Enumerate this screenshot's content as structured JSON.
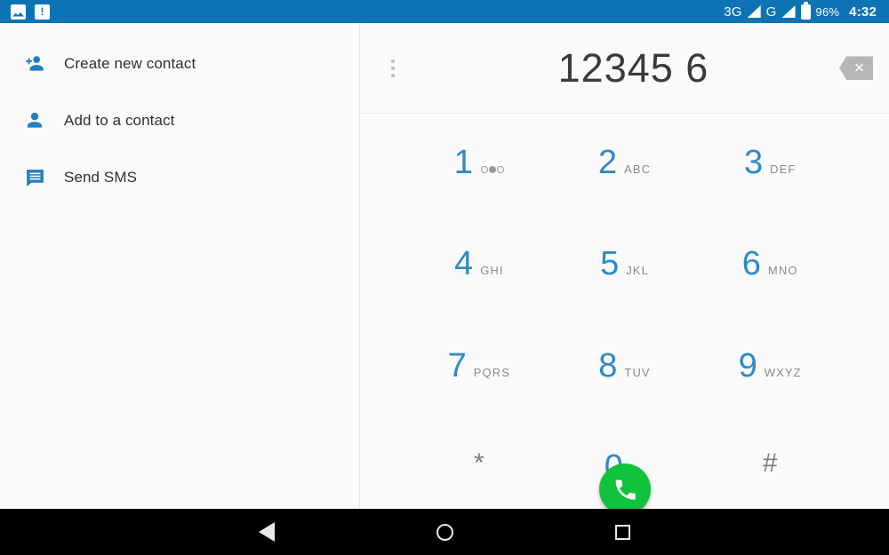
{
  "status_bar": {
    "notifications": [
      {
        "name": "screenshot-icon"
      },
      {
        "name": "document-alert-icon"
      }
    ],
    "network_1": "3G",
    "network_2": "G",
    "battery_percent": "96%",
    "time": "4:32",
    "background_color": "#0c74b5"
  },
  "left_panel": {
    "items": [
      {
        "label": "Create new contact",
        "icon": "person-add-icon"
      },
      {
        "label": "Add to a contact",
        "icon": "person-icon"
      },
      {
        "label": "Send SMS",
        "icon": "message-icon"
      }
    ],
    "icon_color": "#1f7fc0"
  },
  "dialer": {
    "overflow_menu_label": "More options",
    "number": "12345 6",
    "backspace_label": "Backspace",
    "accent_color": "#2f89c8",
    "call_button_color": "#11c23c",
    "keys": [
      {
        "digit": "1",
        "sub": "",
        "icon": "voicemail-icon"
      },
      {
        "digit": "2",
        "sub": "ABC",
        "icon": ""
      },
      {
        "digit": "3",
        "sub": "DEF",
        "icon": ""
      },
      {
        "digit": "4",
        "sub": "GHI",
        "icon": ""
      },
      {
        "digit": "5",
        "sub": "JKL",
        "icon": ""
      },
      {
        "digit": "6",
        "sub": "MNO",
        "icon": ""
      },
      {
        "digit": "7",
        "sub": "PQRS",
        "icon": ""
      },
      {
        "digit": "8",
        "sub": "TUV",
        "icon": ""
      },
      {
        "digit": "9",
        "sub": "WXYZ",
        "icon": ""
      },
      {
        "digit": "*",
        "sub": "",
        "icon": ""
      },
      {
        "digit": "0",
        "sub": "+",
        "icon": ""
      },
      {
        "digit": "#",
        "sub": "",
        "icon": ""
      }
    ],
    "call_label": "Call"
  },
  "nav_bar": {
    "back": "Back",
    "home": "Home",
    "recents": "Recent apps"
  }
}
